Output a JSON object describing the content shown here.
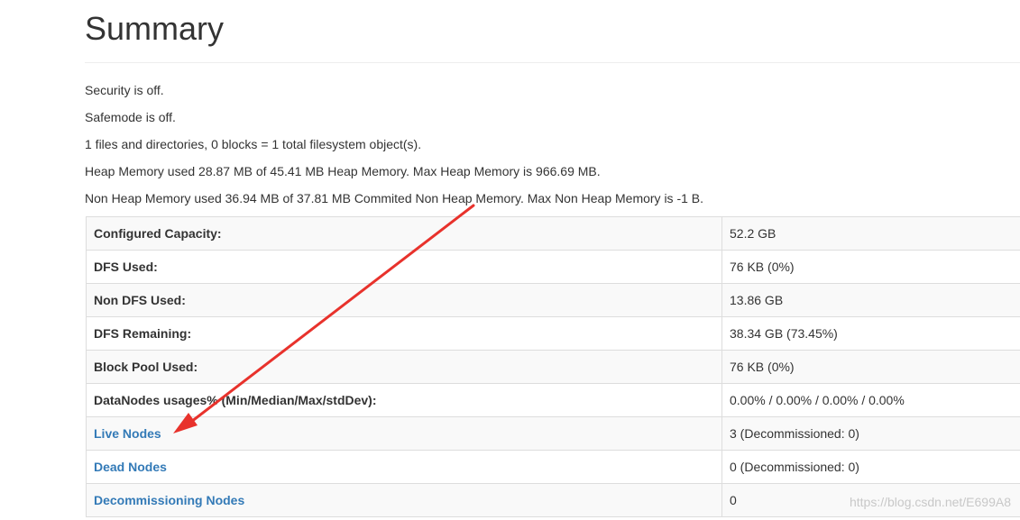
{
  "page": {
    "title": "Summary"
  },
  "status": [
    "Security is off.",
    "Safemode is off.",
    "1 files and directories, 0 blocks = 1 total filesystem object(s).",
    "Heap Memory used 28.87 MB of 45.41 MB Heap Memory. Max Heap Memory is 966.69 MB.",
    "Non Heap Memory used 36.94 MB of 37.81 MB Commited Non Heap Memory. Max Non Heap Memory is -1 B."
  ],
  "table": {
    "rows": [
      {
        "label": "Configured Capacity:",
        "value": "52.2 GB"
      },
      {
        "label": "DFS Used:",
        "value": "76 KB (0%)"
      },
      {
        "label": "Non DFS Used:",
        "value": "13.86 GB"
      },
      {
        "label": "DFS Remaining:",
        "value": "38.34 GB (73.45%)"
      },
      {
        "label": "Block Pool Used:",
        "value": "76 KB (0%)"
      },
      {
        "label": "DataNodes usages% (Min/Median/Max/stdDev):",
        "value": "0.00% / 0.00% / 0.00% / 0.00%"
      },
      {
        "label": "Live Nodes",
        "value": "3 (Decommissioned: 0)"
      },
      {
        "label": "Dead Nodes",
        "value": "0 (Decommissioned: 0)"
      },
      {
        "label": "Decommissioning Nodes",
        "value": "0"
      }
    ]
  },
  "annotation": {
    "arrow_color": "#e8322c"
  },
  "watermark": "https://blog.csdn.net/E699A8",
  "colors": {
    "link": "#337ab7",
    "text": "#333333",
    "border": "#dddddd",
    "stripe": "#f9f9f9"
  }
}
